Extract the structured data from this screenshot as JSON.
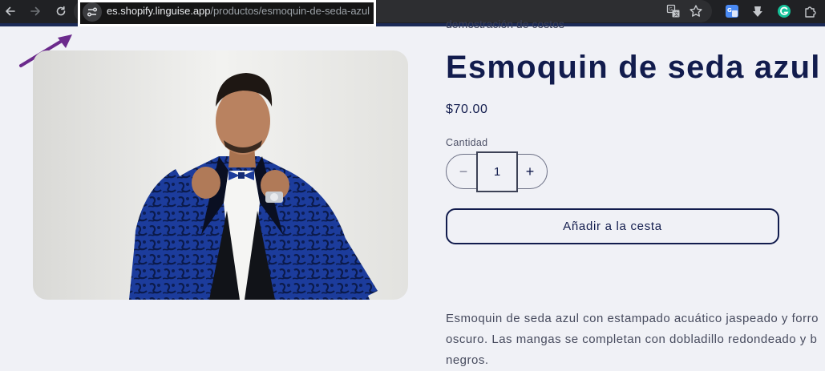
{
  "browser": {
    "url_host": "es.shopify.linguise.app",
    "url_path": "/productos/esmoquin-de-seda-azul",
    "colors": {
      "chrome": "#202124",
      "highlight_border": "#ffffff",
      "annotation_arrow": "#6b2a8c"
    },
    "icons": [
      "back-arrow-icon",
      "forward-arrow-icon",
      "reload-icon",
      "site-info-icon",
      "translate-icon",
      "bookmark-star-icon",
      "google-translate-extension-icon",
      "download-extension-icon",
      "grammarly-extension-icon",
      "extensions-puzzle-icon"
    ]
  },
  "product": {
    "subtitle_cut": "demostración de costos",
    "title": "Esmoquin de seda azul",
    "price": "$70.00",
    "quantity_label": "Cantidad",
    "quantity_value": "1",
    "minus_label": "−",
    "plus_label": "+",
    "add_to_cart_label": "Añadir a la cesta",
    "description_lines": [
      "Esmoquin de seda azul con estampado acuático jaspeado y forro",
      "oscuro. Las mangas se completan con dobladillo redondeado y b",
      "negros."
    ],
    "colors": {
      "page_background": "#f0f1f6",
      "title": "#121c4d",
      "button_border": "#121c4d"
    }
  }
}
